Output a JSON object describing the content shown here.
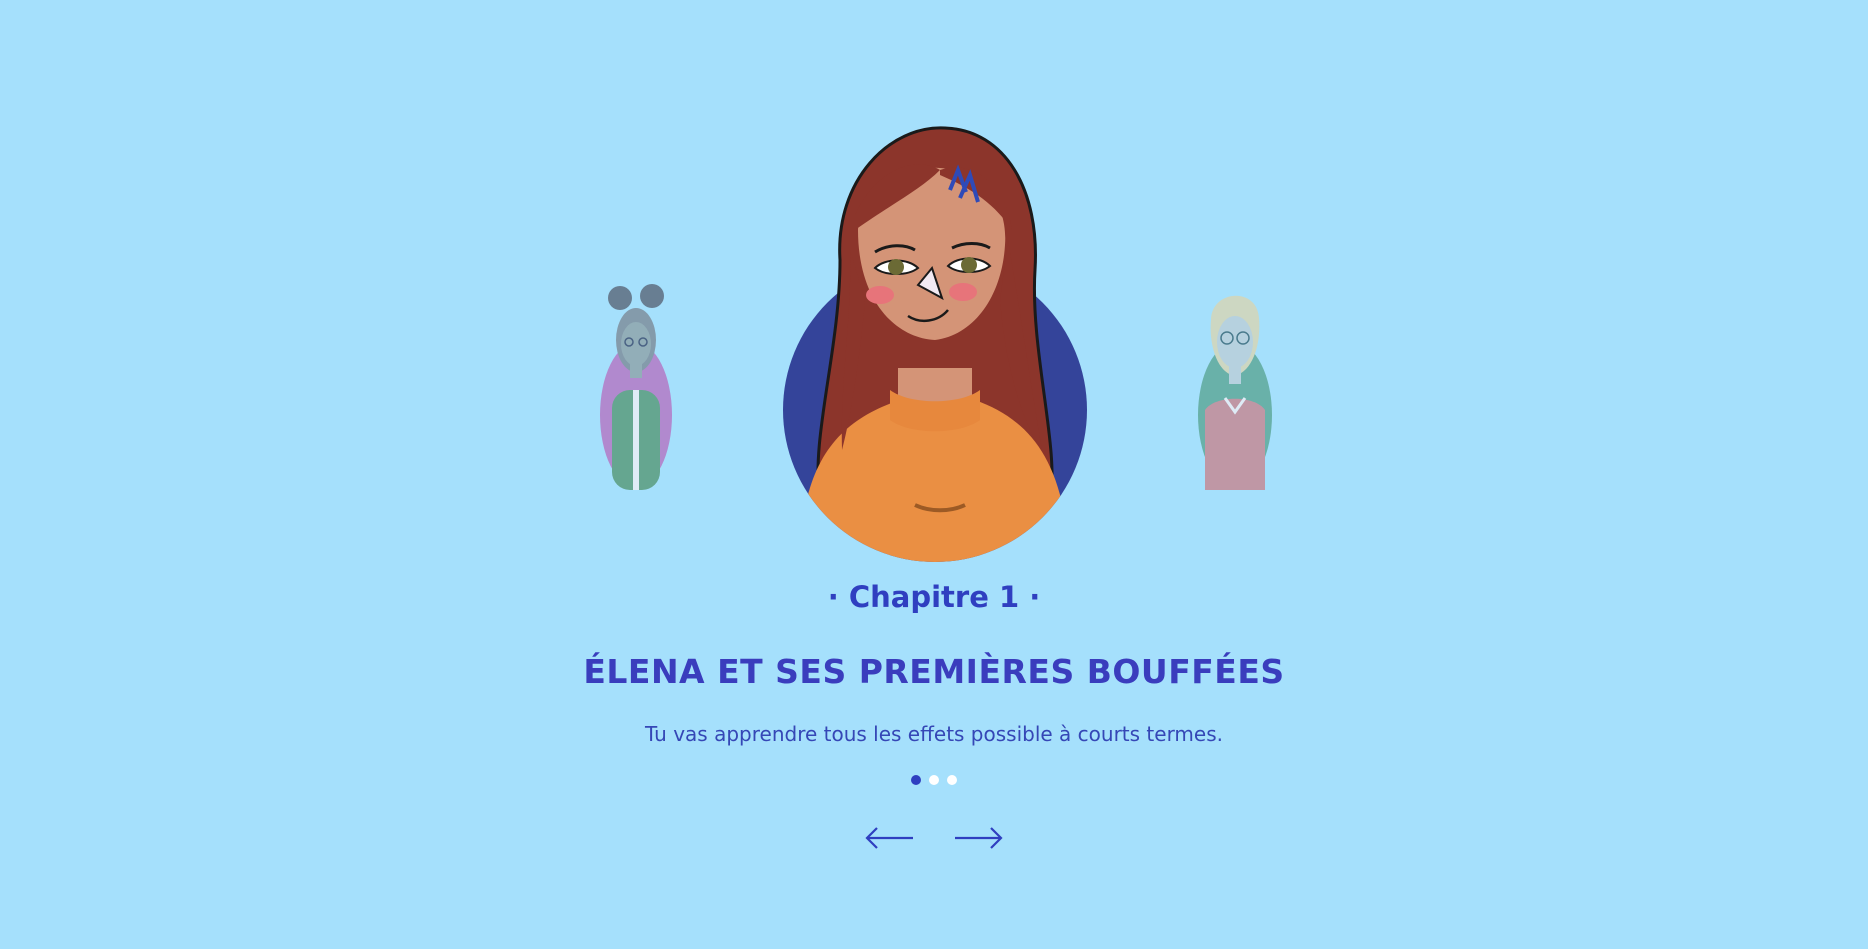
{
  "carousel": {
    "chapter_label": "· Chapitre 1 ·",
    "title": "ÉLENA ET SES PREMIÈRES BOUFFÉES",
    "subtitle": "Tu vas apprendre tous les effets possible à courts termes.",
    "slide_count": 3,
    "active_slide": 1,
    "prev_icon": "arrow-left-icon",
    "next_icon": "arrow-right-icon"
  },
  "colors": {
    "background": "#a5e0fc",
    "accent": "#2f3fc0",
    "dot_inactive": "#ffffff"
  }
}
